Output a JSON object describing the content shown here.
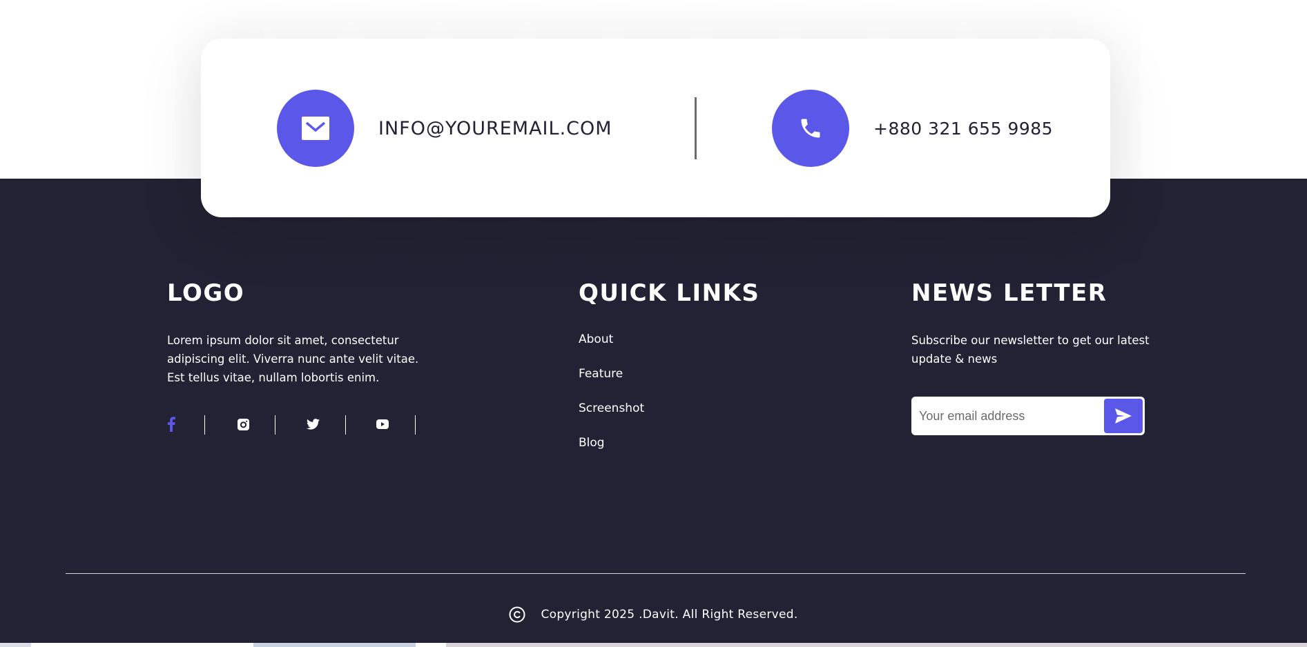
{
  "contact": {
    "email": "INFO@YOUREMAIL.COM",
    "phone": "+880 321 655 9985",
    "email_icon": "envelope-icon",
    "phone_icon": "phone-icon"
  },
  "about": {
    "title": "LOGO",
    "description": "Lorem ipsum dolor sit amet, consectetur adipiscing elit. Viverra nunc ante velit vitae. Est tellus vitae, nullam lobortis enim.",
    "socials": [
      {
        "icon": "facebook-icon"
      },
      {
        "icon": "instagram-icon"
      },
      {
        "icon": "twitter-icon"
      },
      {
        "icon": "youtube-icon"
      }
    ]
  },
  "quick_links": {
    "title": "QUICK LINKS",
    "items": [
      "About",
      "Feature",
      "Screenshot",
      "Blog"
    ]
  },
  "newsletter": {
    "title": "NEWS LETTER",
    "description": "Subscribe our newsletter to get our latest update & news",
    "placeholder": "Your email address",
    "value": "",
    "send_icon": "send-icon"
  },
  "copyright": {
    "text": "Copyright 2025 .Davit. All Right Reserved.",
    "icon": "copyright-icon"
  },
  "colors": {
    "accent": "#5b57e8",
    "footer_bg": "#232234",
    "card_bg": "#ffffff"
  }
}
